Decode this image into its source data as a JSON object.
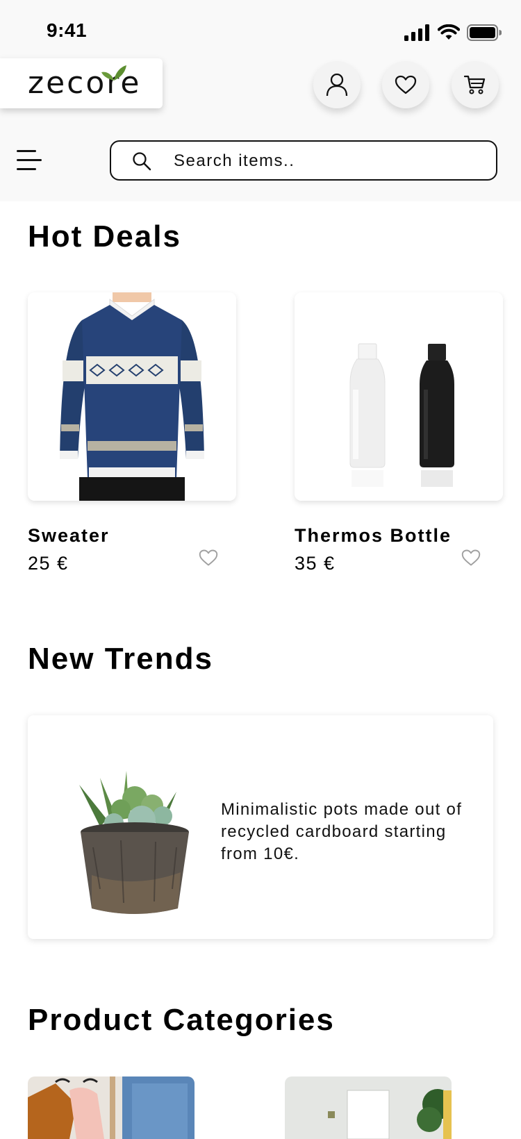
{
  "status_bar": {
    "time": "9:41"
  },
  "brand": {
    "logo_text": "zecore"
  },
  "search": {
    "placeholder": "Search items.."
  },
  "hot_deals": {
    "title": "Hot Deals",
    "products": [
      {
        "name": "Sweater",
        "price": "25 €"
      },
      {
        "name": "Thermos Bottle",
        "price": "35 €"
      }
    ]
  },
  "new_trends": {
    "title": "New Trends",
    "description": "Minimalistic pots made out of recycled cardboard starting from 10€."
  },
  "categories": {
    "title": "Product Categories"
  },
  "colors": {
    "leaf": "#6a9a3a",
    "brand_o": "#8a6a45",
    "sweater": "#233f6e"
  }
}
